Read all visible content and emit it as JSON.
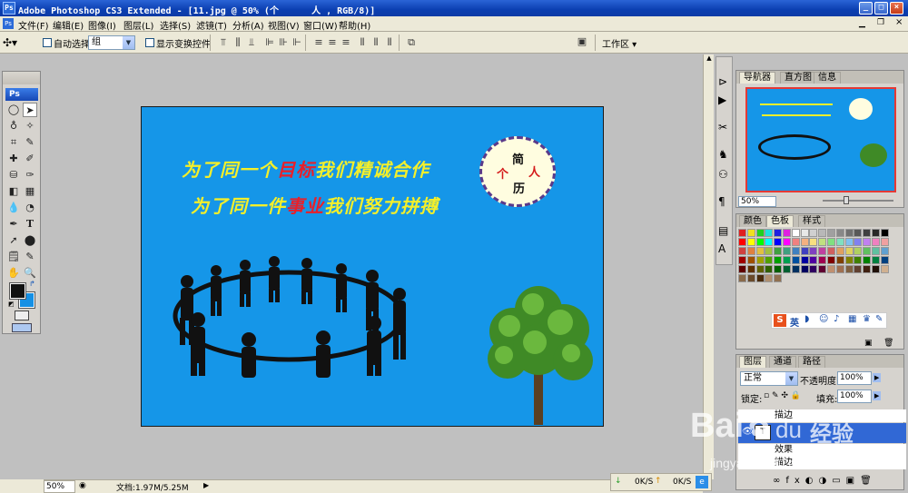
{
  "window": {
    "title": "Adobe Photoshop CS3 Extended - [11.jpg @ 50% (个      人 , RGB/8)]",
    "logo": "Ps",
    "min": "_",
    "max": "□",
    "close": "×"
  },
  "menu": [
    "文件(F)",
    "编辑(E)",
    "图像(I)",
    "图层(L)",
    "选择(S)",
    "滤镜(T)",
    "分析(A)",
    "视图(V)",
    "窗口(W)",
    "帮助(H)"
  ],
  "options": {
    "auto_select_label": "自动选择:",
    "auto_select_value": "组",
    "show_transform_label": "显示变换控件",
    "workspace_label": "工作区 ▾"
  },
  "toolbox": {
    "badge": "Ps"
  },
  "document": {
    "line1_parts": [
      "为了同一个",
      "目标",
      "我们精诚合作"
    ],
    "line2_parts": [
      "为了同一件",
      "事业",
      "我们努力拼搏"
    ],
    "badge_chars": [
      "简",
      "个",
      "人",
      "历"
    ],
    "colors": {
      "canvas": "#1596e8",
      "yellow": "#f4ef2a",
      "red": "#e8202a"
    }
  },
  "status": {
    "zoom": "50%",
    "doc_size": "文档:1.97M/5.25M"
  },
  "navigator": {
    "tabs": [
      "导航器",
      "直方图",
      "信息"
    ],
    "zoom": "50%"
  },
  "swatches": {
    "tabs": [
      "颜色",
      "色板",
      "样式"
    ]
  },
  "ime": {
    "label": "英"
  },
  "layers": {
    "tabs": [
      "图层",
      "通道",
      "路径"
    ],
    "blend_mode": "正常",
    "opacity_label": "不透明度:",
    "opacity": "100%",
    "lock_label": "锁定:",
    "fill_label": "填充:",
    "fill": "100%",
    "rows": [
      "描边",
      "效果",
      "描边"
    ]
  },
  "tray": {
    "down": "0K/S",
    "up": "0K/S"
  },
  "watermark": {
    "brand": "Bai",
    "du": "du",
    "jy": "经验",
    "url": "jingyan.baidu.com"
  }
}
